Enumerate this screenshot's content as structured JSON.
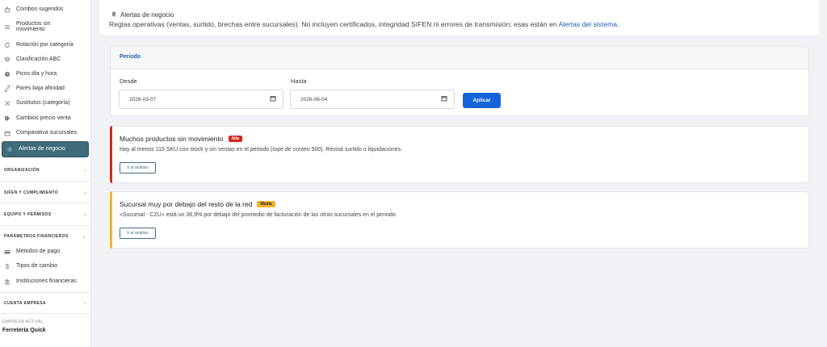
{
  "sidebar": {
    "items": [
      {
        "label": "Combos sugeridos",
        "icon": "basket-icon"
      },
      {
        "label": "Productos sin movimiento",
        "icon": "layers-icon"
      },
      {
        "label": "Rotación por categoría",
        "icon": "refresh-icon"
      },
      {
        "label": "Clasificación ABC",
        "icon": "stack-icon"
      },
      {
        "label": "Picos día y hora",
        "icon": "clock-icon"
      },
      {
        "label": "Pares baja afinidad",
        "icon": "link-icon"
      },
      {
        "label": "Sustitutos (categoría)",
        "icon": "shuffle-icon"
      },
      {
        "label": "Cambios precio venta",
        "icon": "tag-icon"
      },
      {
        "label": "Comparativa sucursales",
        "icon": "store-icon"
      },
      {
        "label": "Alertas de negocio",
        "icon": "alert-icon"
      }
    ],
    "sections": {
      "organizacion": "ORGANIZACIÓN",
      "sifen": "SIFEN Y CUMPLIMIENTO",
      "equipo": "EQUIPO Y PERMISOS",
      "parametros": "PARÁMETROS FINANCIEROS",
      "cuenta": "CUENTA EMPRESA"
    },
    "financial_items": [
      {
        "label": "Métodos de pago",
        "icon": "card-icon"
      },
      {
        "label": "Tipos de cambio",
        "icon": "dollar-icon"
      },
      {
        "label": "Instituciones financieras",
        "icon": "bank-icon"
      }
    ],
    "company_label": "EMPRESA ACTUAL",
    "company_name": "Ferretería Quick"
  },
  "header": {
    "title": "Alertas de negocio",
    "description": "Reglas operativas (ventas, surtido, brechas entre sucursales). No incluyen certificados, integridad SIFEN ni errores de transmisión; esas están en",
    "link": "Alertas del sistema",
    "suffix": "."
  },
  "period": {
    "title": "Periodo",
    "from_label": "Desde",
    "from_value": "2026-03-07",
    "to_label": "Hasta",
    "to_value": "2026-06-04",
    "apply_label": "Aplicar"
  },
  "alerts": [
    {
      "title": "Muchos productos sin movimiento",
      "badge": "Alta",
      "description": "Hay al menos 115 SKU con stock y sin ventas en el periodo (tope de conteo 500). Revisá surtido o liquidaciones.",
      "button": "Ir al análisis",
      "color": "#d7261b"
    },
    {
      "title": "Sucursal muy por debajo del resto de la red",
      "badge": "Media",
      "description": "«Sucursal - CZU» está un 36,9% por debajo del promedio de facturación de las otras sucursales en el periodo.",
      "button": "Ir al análisis",
      "color": "#f0b52b"
    }
  ]
}
